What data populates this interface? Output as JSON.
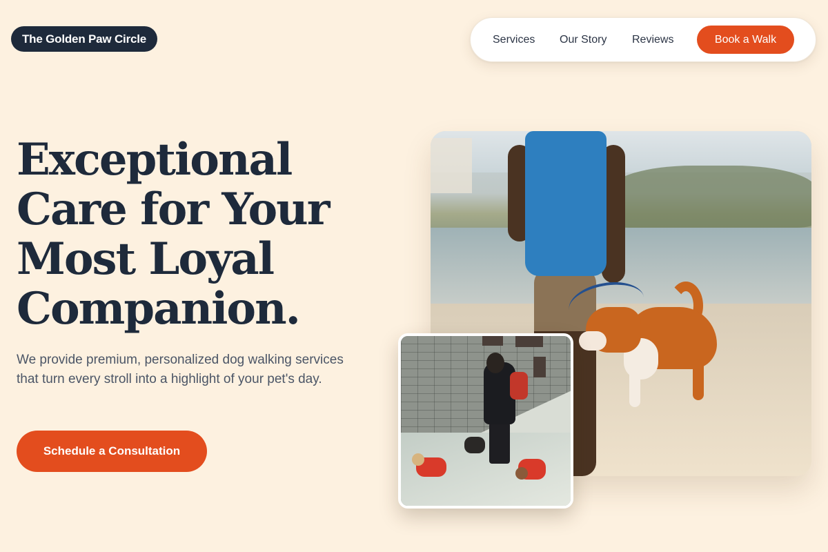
{
  "brand": {
    "name": "The Golden Paw Circle"
  },
  "nav": {
    "items": [
      {
        "label": "Services"
      },
      {
        "label": "Our Story"
      },
      {
        "label": "Reviews"
      }
    ],
    "cta_label": "Book a Walk"
  },
  "hero": {
    "title_lines": [
      "Exceptional",
      "Care for Your",
      "Most Loyal",
      "Companion."
    ],
    "subtitle": "We provide premium, personalized dog walking services that turn every stroll into a highlight of your pet's day.",
    "cta_label": "Schedule a Consultation"
  },
  "colors": {
    "background": "#fdf1e0",
    "navy": "#1e2a3b",
    "accent": "#e34d1e"
  }
}
